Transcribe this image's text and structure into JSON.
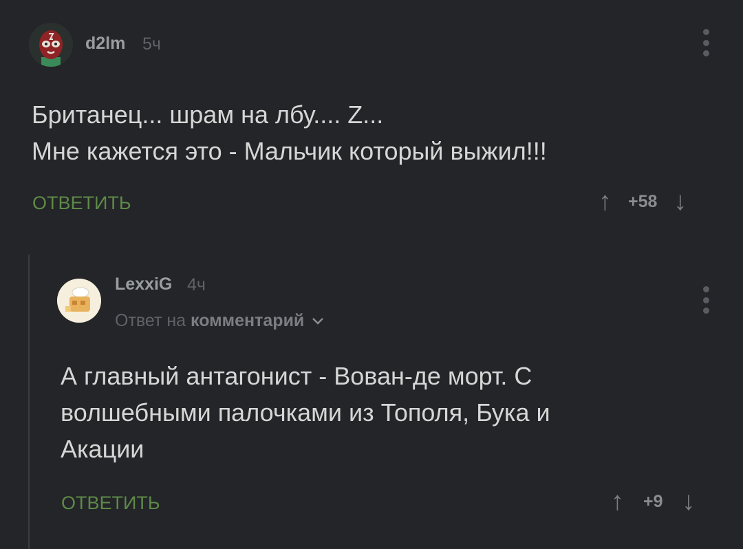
{
  "comments": [
    {
      "author": "d2lm",
      "time": "5ч",
      "lines": [
        "Британец... шрам на лбу.... Z...",
        "Мне кажется это - Мальчик который выжил!!!"
      ],
      "reply_label": "ОТВЕТИТЬ",
      "score": "+58",
      "avatar_icon": "luchador-mask-avatar"
    },
    {
      "author": "LexxiG",
      "time": "4ч",
      "reply_to_prefix": "Ответ на",
      "reply_to_target": "комментарий",
      "lines": [
        "А главный антагонист - Вован-де морт. С",
        "волшебными палочками из Тополя, Бука и",
        "Акации"
      ],
      "reply_label": "ОТВЕТИТЬ",
      "score": "+9",
      "avatar_icon": "chef-house-avatar"
    }
  ],
  "colors": {
    "background": "#232528",
    "reply_button": "#5e8a48",
    "thread_line": "#3a3c40"
  },
  "icons": {
    "up": "↑",
    "down": "↓",
    "chevron": "chevron-down-icon",
    "more": "more-vertical-icon"
  }
}
